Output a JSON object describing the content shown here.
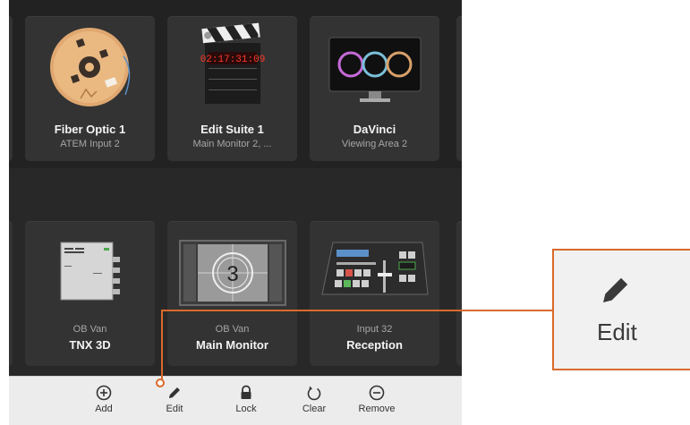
{
  "top_tiles": [
    {
      "title": "Fiber Optic 1",
      "subtitle": "ATEM Input 2",
      "icon": "fiber-spool-icon"
    },
    {
      "title": "Edit Suite 1",
      "subtitle": "Main Monitor 2, ...",
      "icon": "clapperboard-icon",
      "timecode": "02:17:31:09"
    },
    {
      "title": "DaVinci",
      "subtitle": "Viewing Area 2",
      "icon": "color-wheels-monitor-icon"
    }
  ],
  "bottom_tiles": [
    {
      "group": "OB Van",
      "title": "TNX 3D",
      "icon": "converter-box-icon"
    },
    {
      "group": "OB Van",
      "title": "Main Monitor",
      "icon": "countdown-monitor-icon",
      "countdown": "3"
    },
    {
      "group": "Input 32",
      "title": "Reception",
      "icon": "switcher-panel-icon"
    }
  ],
  "toolbar": {
    "add_label": "Add",
    "edit_label": "Edit",
    "lock_label": "Lock",
    "clear_label": "Clear",
    "remove_label": "Remove"
  },
  "callout": {
    "label": "Edit",
    "icon": "pencil-icon"
  },
  "colors": {
    "accent": "#d96a2c",
    "panel": "#222222",
    "tile": "#333333",
    "toolbar": "#ececec"
  }
}
